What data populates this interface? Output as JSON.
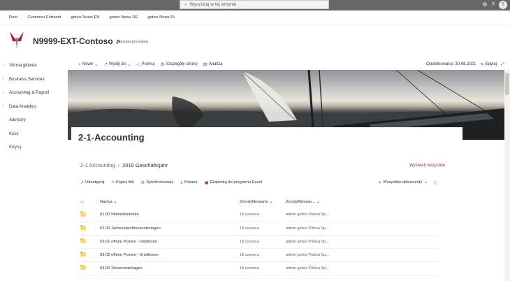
{
  "suitebar": {
    "search_placeholder": "Wyszukaj w tej witrynie",
    "avatar_initials": "T"
  },
  "hubnav": {
    "items": [
      "Root",
      "Customer Extranet",
      "getsix News EN",
      "getsix News DE",
      "getsix News PL"
    ]
  },
  "header": {
    "site_title": "N9999-EXT-Contoso",
    "group_label": "Grupa prywatna"
  },
  "leftnav": {
    "items": [
      {
        "label": "Strona główna",
        "expandable": true
      },
      {
        "label": "Business Services",
        "expandable": true
      },
      {
        "label": "Accounting & Payroll",
        "expandable": true
      },
      {
        "label": "Data Analytics",
        "expandable": true
      },
      {
        "label": "Advisory",
        "expandable": false
      },
      {
        "label": "Kosz",
        "expandable": false
      },
      {
        "label": "Edytuj",
        "expandable": false
      }
    ]
  },
  "cmdbar": {
    "new": "Nowe",
    "send": "Wyślij do",
    "promote": "Promuj",
    "details": "Szczegóły strony",
    "analytics": "Analiza",
    "published": "Opublikowano: 30.08.2021",
    "edit": "Edytuj"
  },
  "page": {
    "title": "2-1-Accounting"
  },
  "library": {
    "breadcrumb_root": "2-1 Accounting",
    "breadcrumb_current": "2010 Geschäftsjahr",
    "view_all": "Wyświetl wszystkie",
    "commands": {
      "share": "Udostępnij",
      "copy_link": "Kopiuj link",
      "sync": "Synchronizacja",
      "download": "Pobierz",
      "export": "Eksportuj do programu Excel"
    },
    "view": "Wszystkie dokumenty",
    "columns": {
      "name": "Nazwa",
      "modified": "Zmodyfikowane",
      "modified_by": "Zmodyfikowan..."
    },
    "rows": [
      {
        "name": "01.00 Monatsberichte",
        "modified": "18 czerwca",
        "modified_by": "admin getsix Polska Sp..."
      },
      {
        "name": "02.00 Jahresabschlussunterlagen",
        "modified": "18 czerwca",
        "modified_by": "admin getsix Polska Sp..."
      },
      {
        "name": "03.01 offene Posten - Debitoren",
        "modified": "18 czerwca",
        "modified_by": "admin getsix Polska Sp..."
      },
      {
        "name": "03.02 offene Posten - Kreditoren",
        "modified": "18 czerwca",
        "modified_by": "admin getsix Polska Sp..."
      },
      {
        "name": "04.00 Steuerunterlagen",
        "modified": "18 czerwca",
        "modified_by": "admin getsix Polska Sp..."
      }
    ]
  },
  "colors": {
    "accent": "#a4262c",
    "suitebar": "#676767",
    "folder": "#f8d775"
  }
}
